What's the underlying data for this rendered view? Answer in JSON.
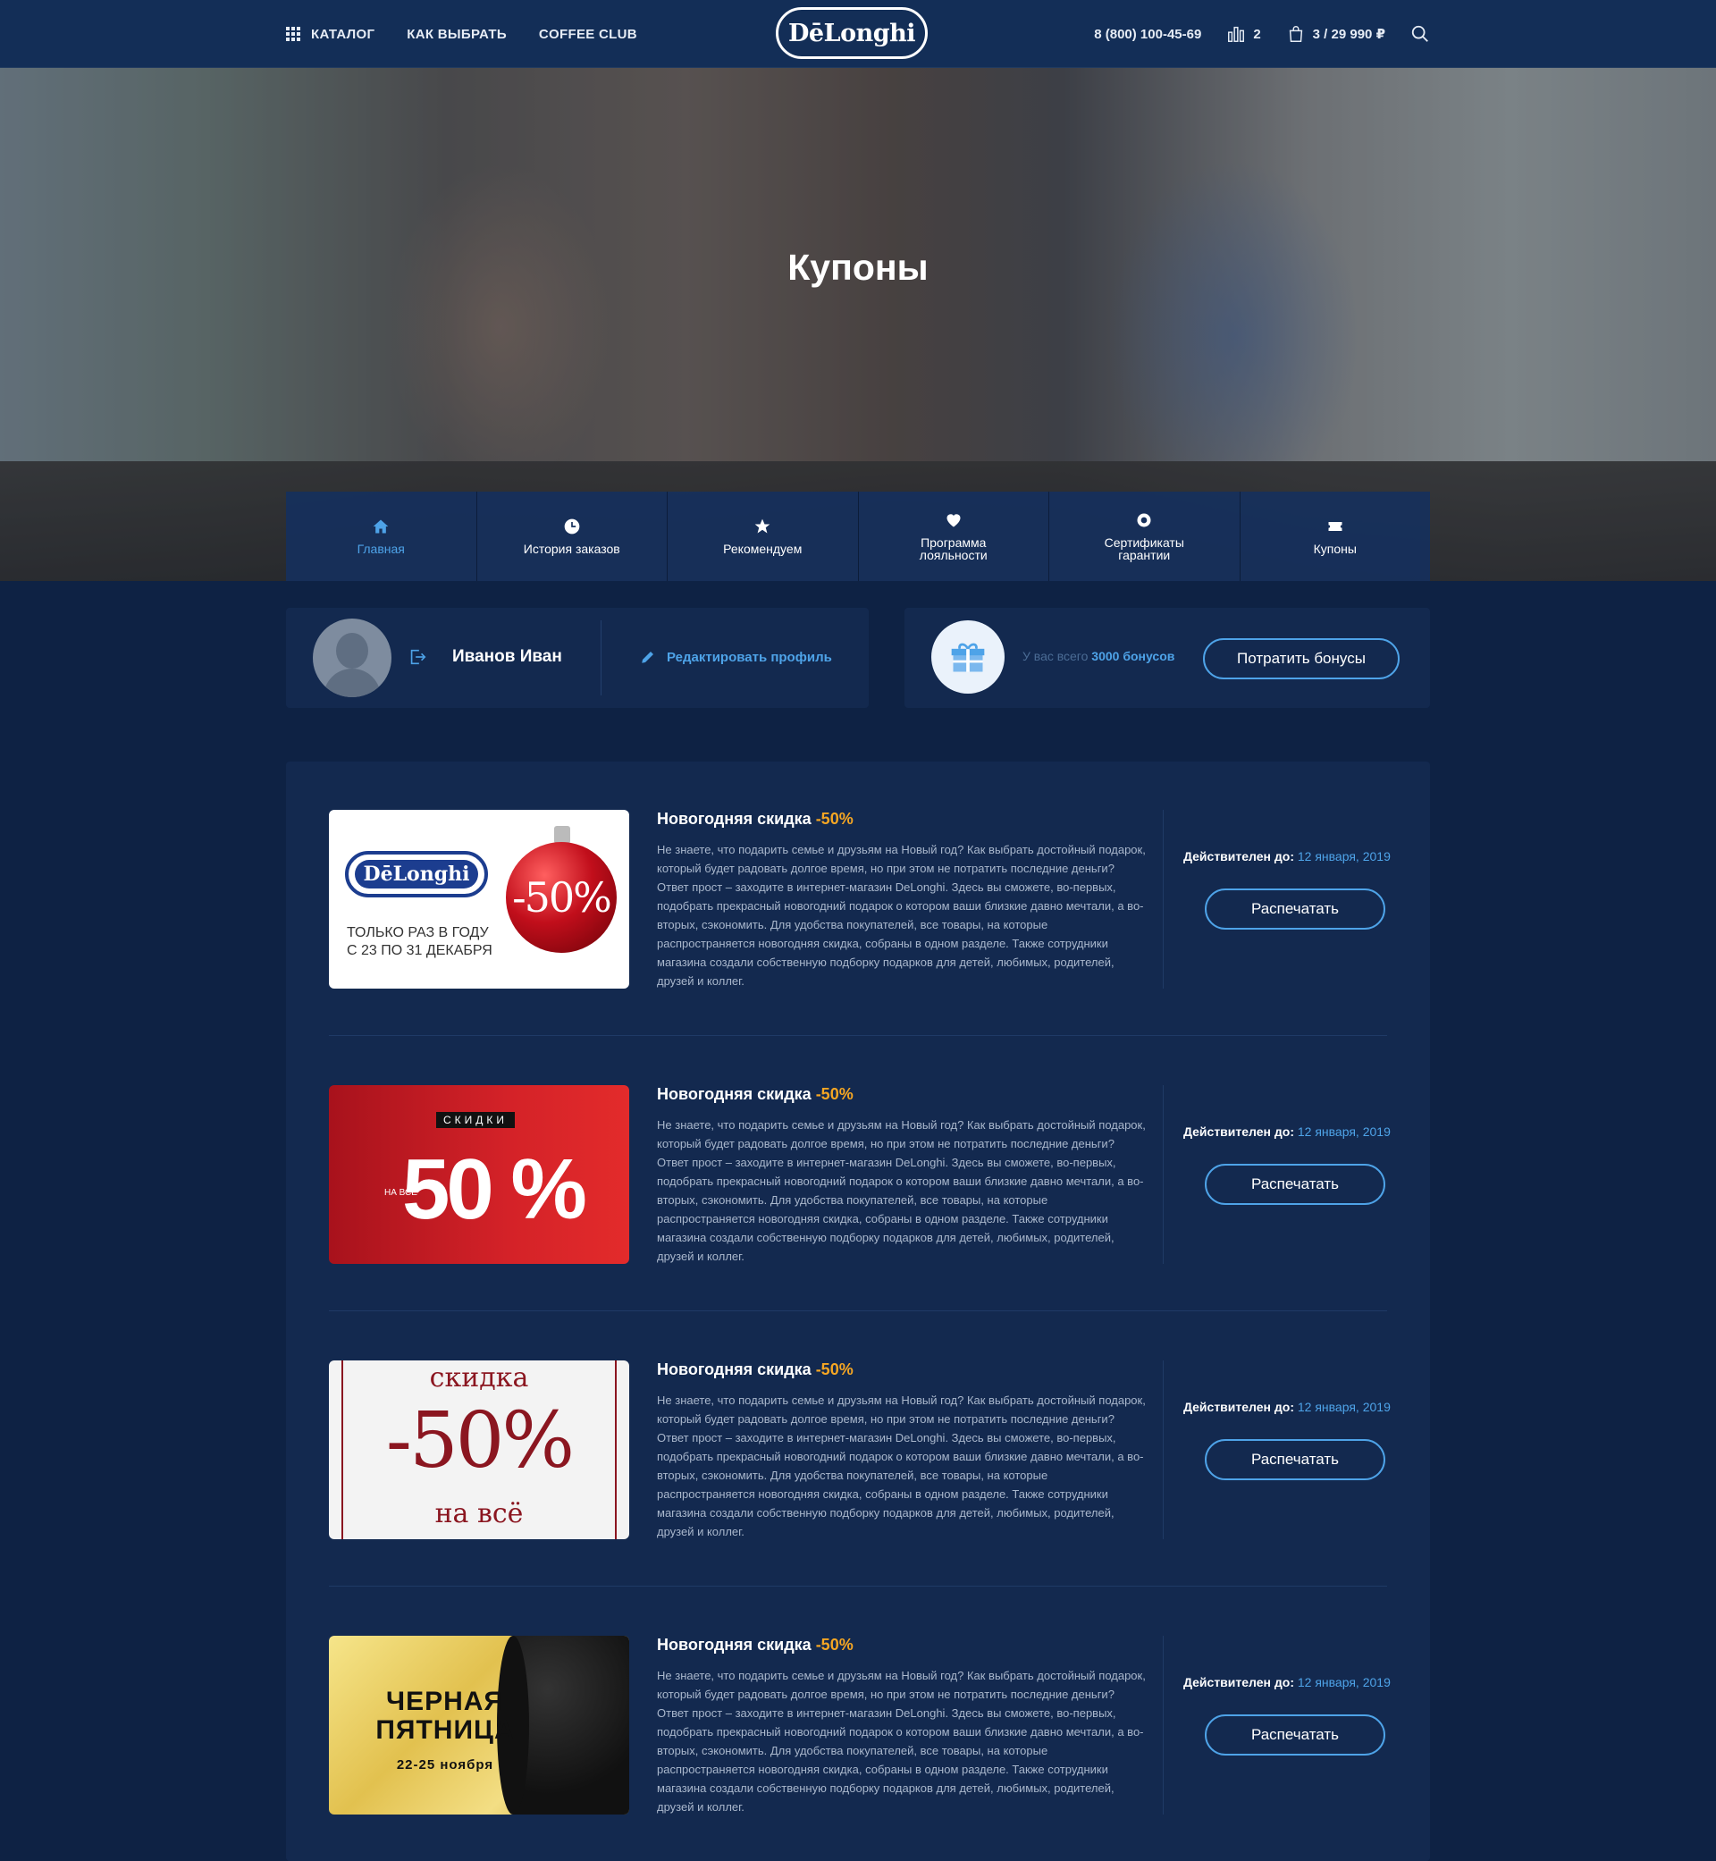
{
  "header": {
    "catalog": "КАТАЛОГ",
    "how_to_choose": "КАК ВЫБРАТЬ",
    "coffee_club": "COFFEE CLUB",
    "logo": "DēLonghi",
    "phone": "8 (800) 100-45-69",
    "compare_count": "2",
    "cart": "3 / 29 990 ₽"
  },
  "hero": {
    "title": "Купоны"
  },
  "subnav": [
    {
      "label": "Главная",
      "icon": "home-icon",
      "active": true
    },
    {
      "label": "История заказов",
      "icon": "clock-icon",
      "active": false
    },
    {
      "label": "Рекомендуем",
      "icon": "star-icon",
      "active": false
    },
    {
      "label": "Программа лояльности",
      "icon": "heart-icon",
      "active": false
    },
    {
      "label": "Сертификаты гарантии",
      "icon": "badge-icon",
      "active": false
    },
    {
      "label": "Купоны",
      "icon": "ticket-icon",
      "active": false
    }
  ],
  "profile": {
    "name": "Иванов Иван",
    "edit": "Редактировать профиль"
  },
  "bonus": {
    "prefix": "У вас всего",
    "amount": "3000 бонусов",
    "button": "Потратить бонусы"
  },
  "coupons": [
    {
      "title": "Новогодняя скидка",
      "percent": "-50%",
      "description": "Не знаете, что подарить семье и друзьям на Новый год? Как выбрать достойный подарок, который будет радовать долгое время, но при этом не потратить последние деньги? Ответ прост – заходите в интернет-магазин DeLonghi. Здесь вы сможете, во-первых, подобрать прекрасный новогодний подарок о котором ваши близкие давно мечтали, а во-вторых, сэкономить. Для удобства покупателей, все товары, на которые распространяется новогодняя скидка, собраны в одном разделе. Также сотрудники магазина создали собственную подборку подарков для детей, любимых, родителей, друзей и коллег.",
      "valid_label": "Действителен до:",
      "valid_date": "12 января, 2019",
      "button": "Распечатать",
      "image": {
        "logo": "DēLonghi",
        "line1": "ТОЛЬКО РАЗ В ГОДУ",
        "line2": "С 23 ПО 31 ДЕКАБРЯ",
        "badge": "-50%"
      }
    },
    {
      "title": "Новогодняя скидка",
      "percent": "-50%",
      "description": "Не знаете, что подарить семье и друзьям на Новый год? Как выбрать достойный подарок, который будет радовать долгое время, но при этом не потратить последние деньги? Ответ прост – заходите в интернет-магазин DeLonghi. Здесь вы сможете, во-первых, подобрать прекрасный новогодний подарок о котором ваши близкие давно мечтали, а во-вторых, сэкономить. Для удобства покупателей, все товары, на которые распространяется новогодняя скидка, собраны в одном разделе. Также сотрудники магазина создали собственную подборку подарков для детей, любимых, родителей, друзей и коллег.",
      "valid_label": "Действителен до:",
      "valid_date": "12 января, 2019",
      "button": "Распечатать",
      "image": {
        "tag": "СКИДКИ",
        "small": "НА ВСЁ",
        "big": "50 %"
      }
    },
    {
      "title": "Новогодняя скидка",
      "percent": "-50%",
      "description": "Не знаете, что подарить семье и друзьям на Новый год? Как выбрать достойный подарок, который будет радовать долгое время, но при этом не потратить последние деньги? Ответ прост – заходите в интернет-магазин DeLonghi. Здесь вы сможете, во-первых, подобрать прекрасный новогодний подарок о котором ваши близкие давно мечтали, а во-вторых, сэкономить. Для удобства покупателей, все товары, на которые распространяется новогодняя скидка, собраны в одном разделе. Также сотрудники магазина создали собственную подборку подарков для детей, любимых, родителей, друзей и коллег.",
      "valid_label": "Действителен до:",
      "valid_date": "12 января, 2019",
      "button": "Распечатать",
      "image": {
        "line1": "скидка",
        "big": "-50%",
        "line2": "на всё"
      }
    },
    {
      "title": "Новогодняя скидка",
      "percent": "-50%",
      "description": "Не знаете, что подарить семье и друзьям на Новый год? Как выбрать достойный подарок, который будет радовать долгое время, но при этом не потратить последние деньги? Ответ прост – заходите в интернет-магазин DeLonghi. Здесь вы сможете, во-первых, подобрать прекрасный новогодний подарок о котором ваши близкие давно мечтали, а во-вторых, сэкономить. Для удобства покупателей, все товары, на которые распространяется новогодняя скидка, собраны в одном разделе. Также сотрудники магазина создали собственную подборку подарков для детей, любимых, родителей, друзей и коллег.",
      "valid_label": "Действителен до:",
      "valid_date": "12 января, 2019",
      "button": "Распечатать",
      "image": {
        "line1": "ЧЕРНАЯ ПЯТНИЦА",
        "line2": "22-25 ноября"
      }
    }
  ],
  "colors": {
    "background": "#0e2244",
    "header": "#132e57",
    "card": "#13294f",
    "accent": "#4ea3e8",
    "percent": "#f5a623"
  }
}
